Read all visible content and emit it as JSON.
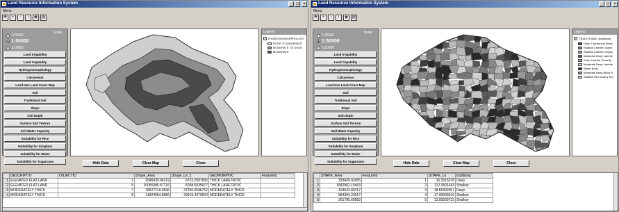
{
  "left": {
    "title": "Land Resource Information System",
    "menu": "Menu",
    "scale": {
      "label": "Scale",
      "opt1": "1:25000",
      "opt2": "1:50000",
      "opt3": "1:10000"
    },
    "nav": [
      "Land Irrigability",
      "Land Capability",
      "Hydrogeomorphology",
      "Calcareous",
      "Land Use Land Cover Map",
      "Soil",
      "Traditional Soil",
      "Slope",
      "Soil Depth",
      "Surface Soil Texture",
      "Soil Water Capacity",
      "Suitability for Rice",
      "Suitability for Sorghum",
      "Suitability for Maize",
      "Suitability for Sugarcane"
    ],
    "legend": {
      "title": "Legend",
      "layer": "HYDROGEOMORPHOLOGY",
      "items": [
        "POOR TO MODERATE",
        "MODERATE TO GOOD",
        "MODERATE"
      ],
      "colors": [
        "#d8d8d8",
        "#8c8c8c",
        "#4a4a4a"
      ]
    },
    "actions": [
      "Hide Data",
      "Clear Map",
      "Close"
    ],
    "table": {
      "headers": [
        "DESCRIPTIO",
        "OBJECTID",
        "Shape_Area",
        "Shape_Le_1",
        "GEOMORPHIC",
        "FeatureId"
      ],
      "rows": [
        {
          "id": "1",
          "c": [
            "ELEVATED FLAT LAND",
            "1",
            "2545939.94319",
            "8722.2997695",
            "THICK LARETRITIC",
            ""
          ]
        },
        {
          "id": "2",
          "c": [
            "ELEVATED FLAT LAND",
            "5",
            "10055385.57716",
            "6068.6035977",
            "THICK LARETRITIC",
            ""
          ]
        },
        {
          "id": "3",
          "c": [
            "MODERATELY THICK",
            "7",
            "18527219.0536",
            "37256.6598752",
            "MODERATELY THICK",
            ""
          ]
        },
        {
          "id": "4",
          "c": [
            "MODERATELY THICK",
            "8",
            "11824084.8086",
            "29919.4379634",
            "MODERATELY THICK",
            ""
          ]
        }
      ]
    }
  },
  "right": {
    "title": "Land Resource Information System",
    "menu": "Menu",
    "scale": {
      "label": "Scale",
      "opt1": "1:25000",
      "opt2": "1:50000",
      "opt3": "1:10000"
    },
    "nav": [
      "Land Irrigability",
      "Land Capability",
      "Hydrogeomorphology",
      "Calcareous",
      "Land Use Land Cover Map",
      "Soil",
      "Traditional Soil",
      "Slope",
      "Soil Depth",
      "Surface Soil Texture",
      "Soil Water Capacity",
      "Suitability for Rice",
      "Suitability for Sorghum",
      "Suitability for Maize",
      "Suitability for Sugarcane"
    ],
    "legend": {
      "title": "Legend",
      "layer": "TRADITIONAL (traditiona)",
      "items": [
        "Deep Calcareous Black",
        "Shallow Laterite Gravel",
        "Shallow Laterite Clayey",
        "Moderate Deep Laterite",
        "Deep Laterite Gravelly",
        "Moderate Deep Laterite",
        "Water Body",
        "Moderate Deep Black S",
        "Shallow Red Loamy Soi"
      ],
      "colors": [
        "#3e3e3e",
        "#777",
        "#9a9a9a",
        "#5a5a5a",
        "#b8b8b8",
        "#d2d2d2",
        "#2a2a2a",
        "#888",
        "#c4c4c4"
      ]
    },
    "actions": [
      "Hide Data",
      "Clear Map",
      "Close"
    ],
    "table": {
      "headers": [
        "SHAPE_Area",
        "FeatureId",
        "SHAPE_Le",
        "traditiona"
      ],
      "rows": [
        {
          "id": "1",
          "c": [
            "333429.92455",
            "1",
            "16.3315378",
            "Deep"
          ]
        },
        {
          "id": "2",
          "c": [
            "1682962.15463",
            "2",
            "112.3501443",
            "Shallow"
          ]
        },
        {
          "id": "3",
          "c": [
            "164633.83317",
            "3",
            "18.66392057",
            "Deep"
          ]
        },
        {
          "id": "4",
          "c": [
            "584394.23617",
            "4",
            "17.00583016",
            "Shallow"
          ]
        },
        {
          "id": "5",
          "c": [
            "301795.69583",
            "5",
            "13.09309723",
            "Shallow"
          ]
        }
      ]
    }
  }
}
